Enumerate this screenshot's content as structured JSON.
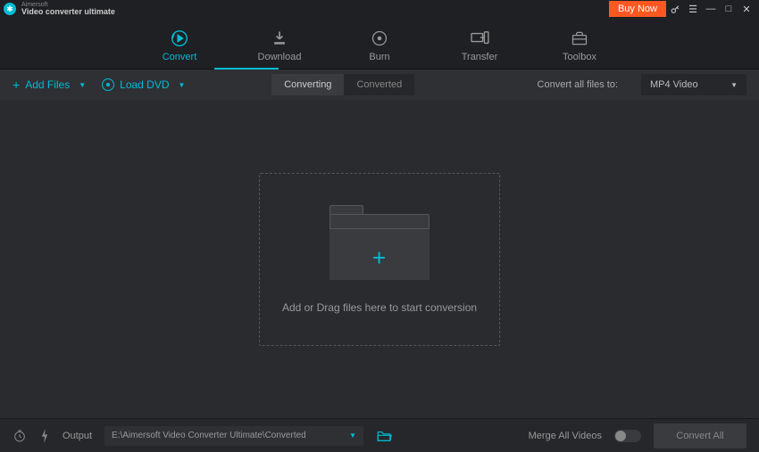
{
  "titlebar": {
    "brand_top": "Aimersoft",
    "brand_bottom": "Video converter ultimate",
    "buy_label": "Buy Now"
  },
  "topnav": {
    "items": [
      {
        "label": "Convert",
        "icon": "play-circle-icon",
        "active": true
      },
      {
        "label": "Download",
        "icon": "download-icon"
      },
      {
        "label": "Burn",
        "icon": "burn-icon"
      },
      {
        "label": "Transfer",
        "icon": "transfer-icon"
      },
      {
        "label": "Toolbox",
        "icon": "toolbox-icon"
      }
    ]
  },
  "subbar": {
    "add_files": "Add Files",
    "load_dvd": "Load DVD",
    "seg_converting": "Converting",
    "seg_converted": "Converted",
    "convert_to_label": "Convert all files to:",
    "format": "MP4 Video"
  },
  "main": {
    "drop_text": "Add or Drag files here to start conversion"
  },
  "bottombar": {
    "output_label": "Output",
    "output_path": "E:\\Aimersoft Video Converter Ultimate\\Converted",
    "merge_label": "Merge All Videos",
    "merge_on": false,
    "convert_label": "Convert All"
  },
  "colors": {
    "accent": "#00bcd4",
    "buy": "#ff5722"
  }
}
